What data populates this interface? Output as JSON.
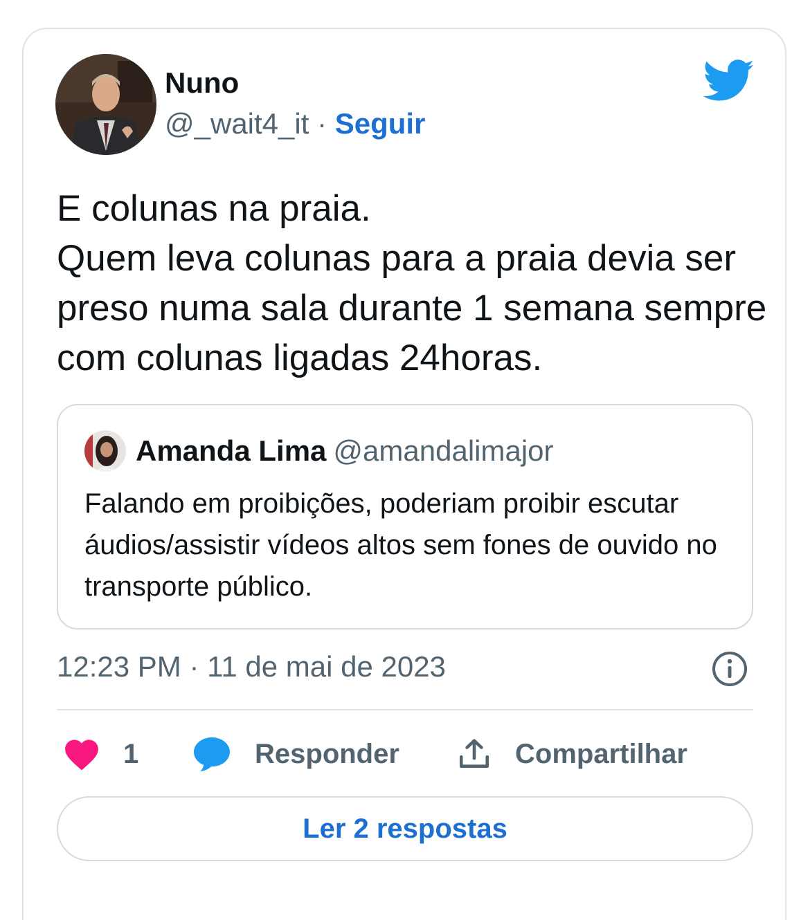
{
  "author": {
    "name": "Nuno",
    "handle": "@_wait4_it",
    "separator": "·",
    "follow_label": "Seguir"
  },
  "tweet": {
    "text": "E colunas na praia.\nQuem leva colunas para a praia devia ser preso numa sala durante 1 semana sempre com colunas ligadas 24horas."
  },
  "quoted": {
    "name": "Amanda Lima",
    "handle": "@amandalimajor",
    "text": "Falando em proibições, poderiam proibir escutar áudios/assistir vídeos altos sem fones de ouvido no transporte público."
  },
  "meta": {
    "timestamp": "12:23 PM · 11 de mai de 2023"
  },
  "actions": {
    "like_count": "1",
    "reply_label": "Responder",
    "share_label": "Compartilhar"
  },
  "read_replies_label": "Ler 2 respostas",
  "icons": [
    "twitter-bird-icon",
    "heart-icon",
    "reply-bubble-icon",
    "share-icon",
    "info-icon"
  ],
  "colors": {
    "brand": "#1d9bf0",
    "link": "#1d6fd1",
    "like": "#f91880",
    "secondary_text": "#536471",
    "border": "#dfe3e7"
  }
}
